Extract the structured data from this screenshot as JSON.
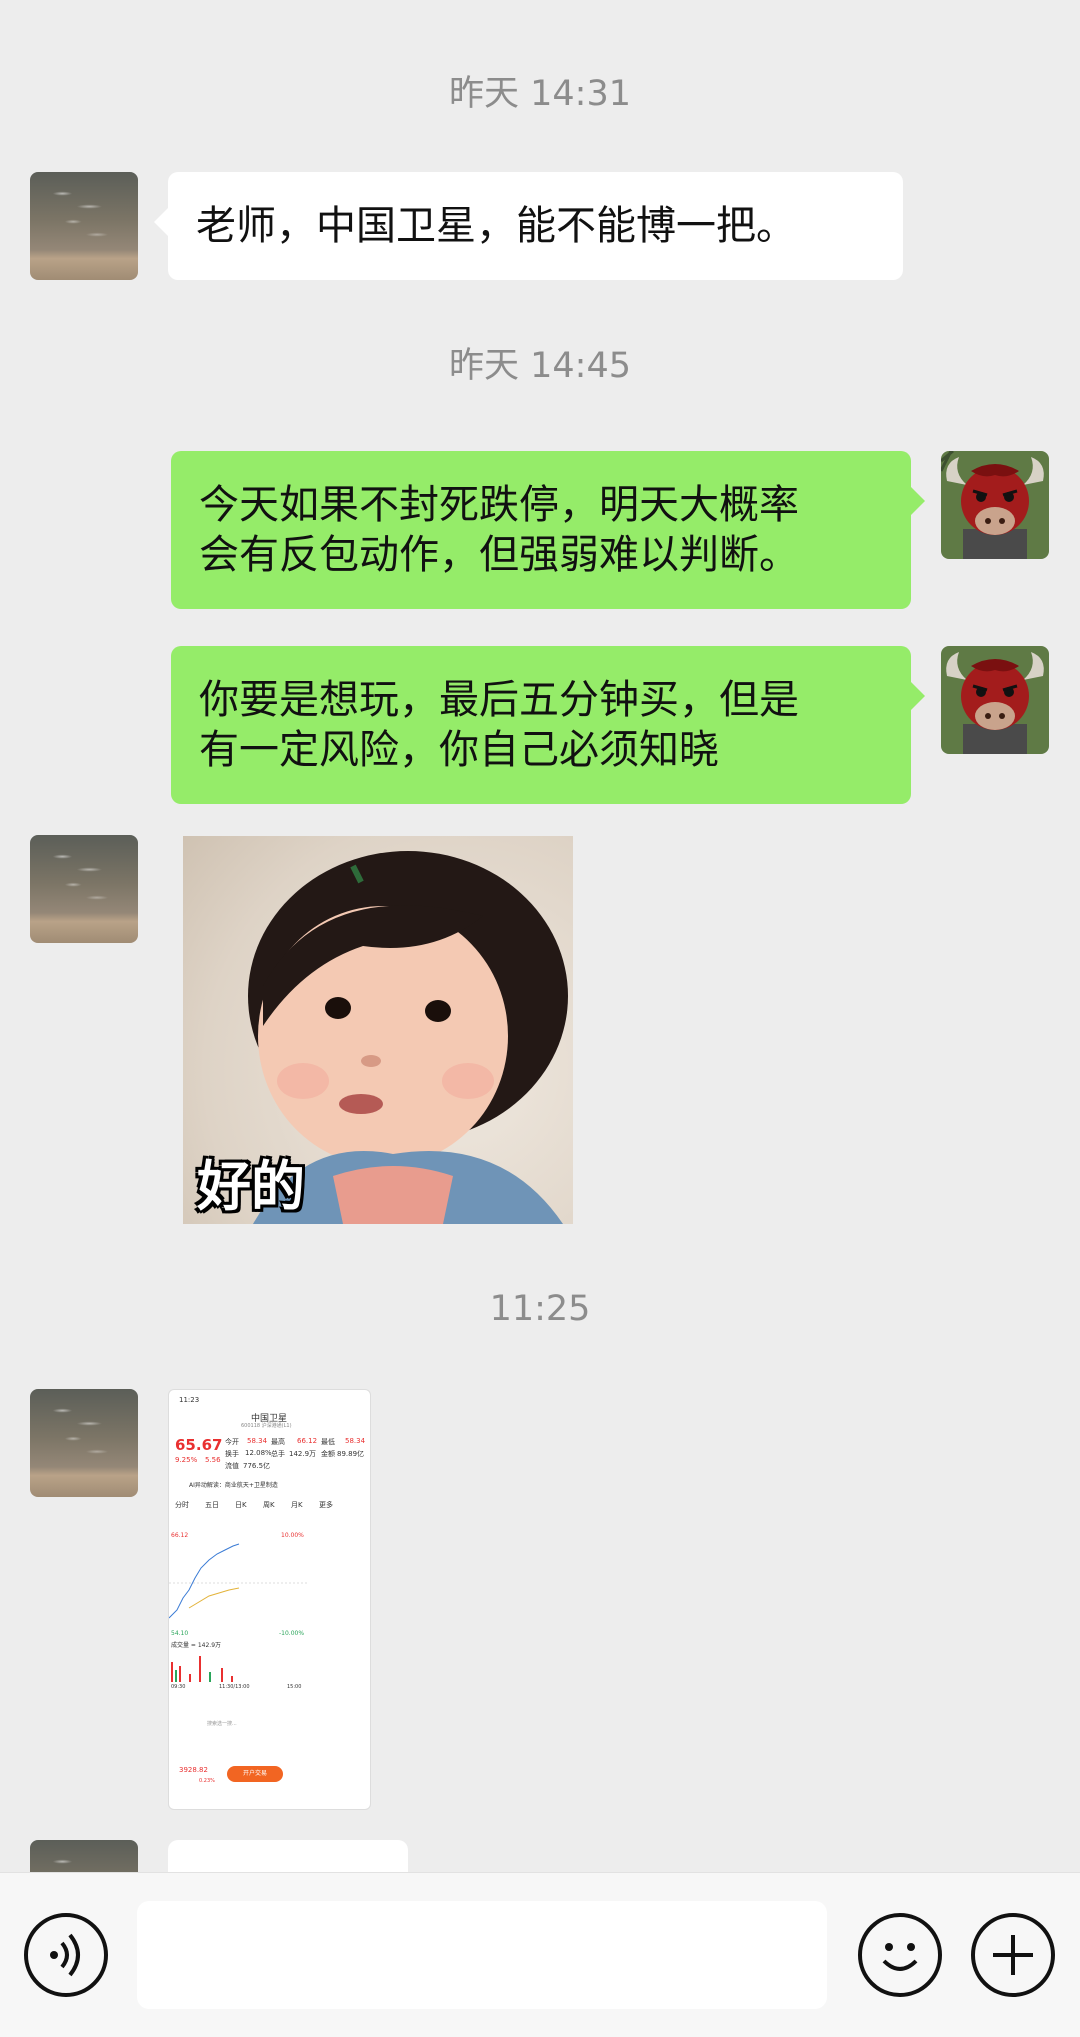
{
  "chat": {
    "timestamps": [
      "昨天 14:31",
      "昨天 14:45",
      "11:25"
    ],
    "messages": [
      {
        "side": "left",
        "text": "老师，中国卫星，能不能博一把。"
      },
      {
        "side": "right",
        "text": "今天如果不封死跌停，明天大概率\n会有反包动作，但强弱难以判断。"
      },
      {
        "side": "right",
        "text": "你要是想玩，最后五分钟买，但是\n有一定风险，你自己必须知晓"
      },
      {
        "side": "left",
        "type": "sticker",
        "caption": "好的"
      },
      {
        "side": "left",
        "type": "screenshot"
      }
    ]
  },
  "stock_screenshot": {
    "status_time": "11:23",
    "name": "中国卫星",
    "code": "600118 沪深港通(L1)",
    "price": "65.67",
    "change_pct": "9.25%",
    "change": "5.56",
    "open_label": "今开",
    "open": "58.34",
    "high_label": "最高",
    "high": "66.12",
    "low_label": "最低",
    "low": "58.34",
    "turnover_label": "换手",
    "turnover": "12.08%",
    "total_cap_label": "总手",
    "total_cap": "142.9万",
    "amount_label": "金额",
    "amount": "89.89亿",
    "float_label": "流值",
    "float": "776.5亿",
    "tabs": [
      "分时",
      "五日",
      "日K",
      "周K",
      "月K",
      "更多"
    ],
    "limit_up": "66.12",
    "limit_up_pct": "10.00%",
    "limit_down": "54.10",
    "limit_down_pct": "-10.00%",
    "volume": "成交量 = 142.9万",
    "time_start": "09:30",
    "time_mid": "11:30/13:00",
    "time_end": "15:00",
    "ai_label": "AI异动解读：商业航天+卫星制造",
    "search_placeholder": "搜索选一搜...",
    "index": "3928.82",
    "index_change": "0.23%",
    "open_account": "开户交易"
  },
  "bottom_bar": {
    "voice_icon": "voice-icon",
    "emoji_icon": "emoji-icon",
    "plus_icon": "plus-icon"
  }
}
